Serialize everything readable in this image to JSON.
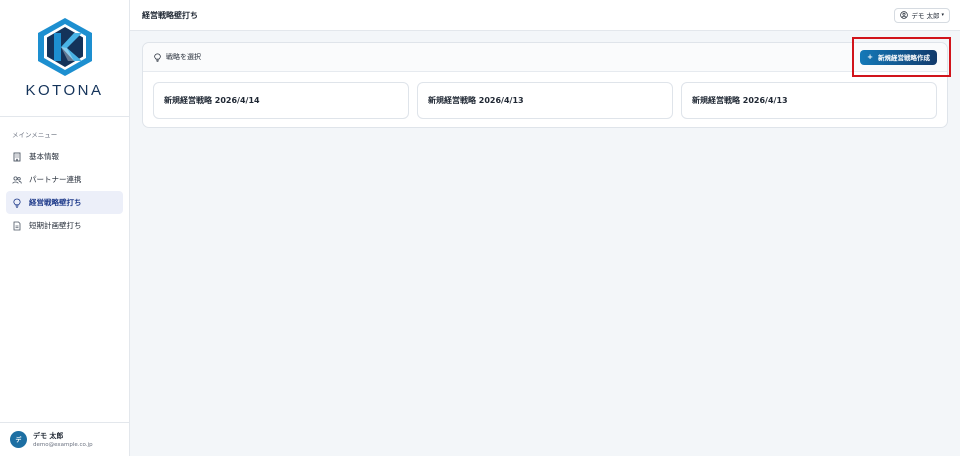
{
  "brand": {
    "name": "KOTONA",
    "primary": "#1479b8",
    "dark": "#14335a"
  },
  "sidebar": {
    "section_label": "メインメニュー",
    "items": [
      {
        "label": "基本情報",
        "icon": "building-icon",
        "active": false
      },
      {
        "label": "パートナー連携",
        "icon": "users-icon",
        "active": false
      },
      {
        "label": "経営戦略壁打ち",
        "icon": "lightbulb-icon",
        "active": true
      },
      {
        "label": "短期計画壁打ち",
        "icon": "document-icon",
        "active": false
      }
    ],
    "user": {
      "avatar": "デ",
      "name": "デモ 太郎",
      "email": "demo@example.co.jp"
    }
  },
  "header": {
    "title": "経営戦略壁打ち",
    "user_menu_label": "デモ 太郎",
    "user_menu_icon": "user-circle-icon"
  },
  "main": {
    "panel_title": "戦略を選択",
    "panel_icon": "lightbulb-icon",
    "create_button": {
      "label": "新規経営戦略作成",
      "icon": "+"
    },
    "cards": [
      {
        "label": "新規経営戦略 2026/4/14"
      },
      {
        "label": "新規経営戦略 2026/4/13"
      },
      {
        "label": "新規経営戦略 2026/4/13"
      }
    ],
    "highlight_color": "#d1141b"
  }
}
